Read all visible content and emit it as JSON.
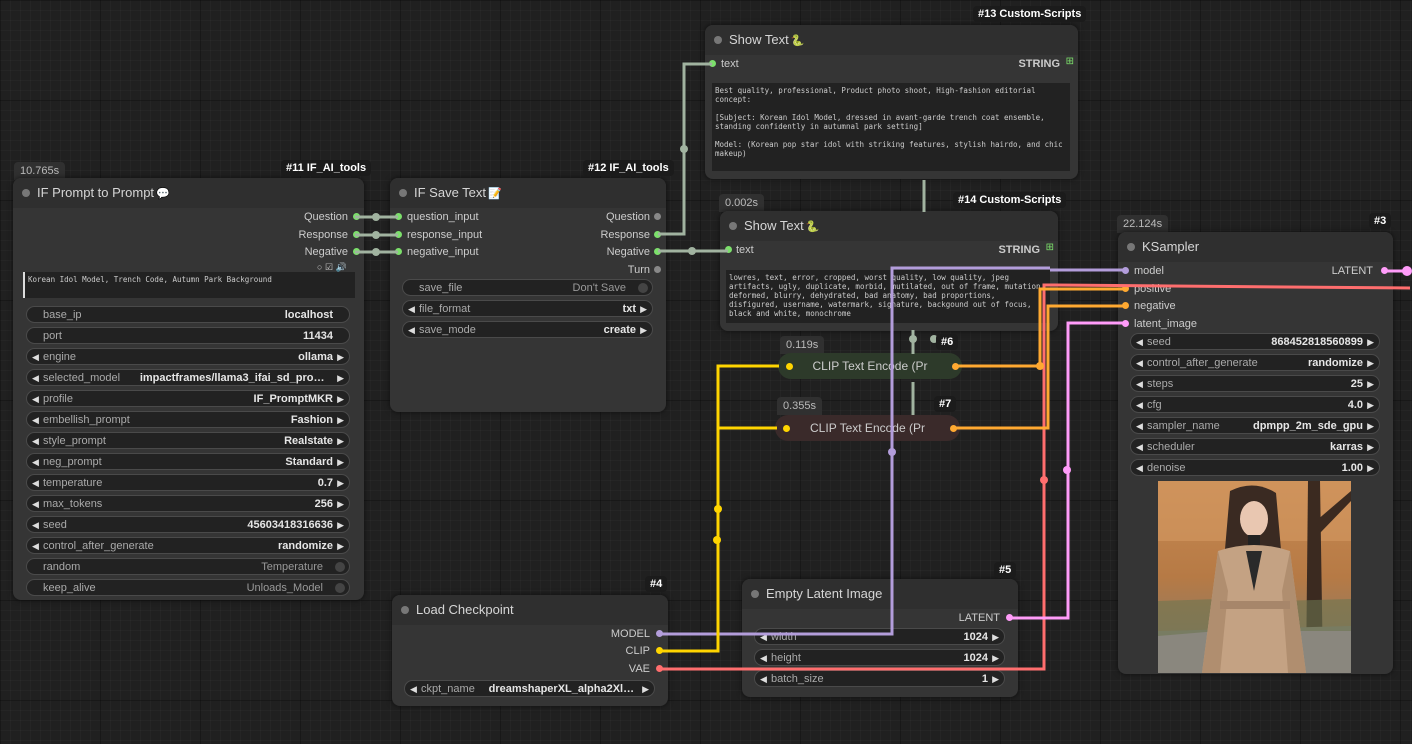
{
  "colors": {
    "clip": "#ffd500",
    "model": "#b39ddb",
    "vae": "#ff6e6e",
    "latent": "#ff9cf9",
    "conditioning": "#ffa931",
    "string": "#a1b3a0",
    "text_pin": "#7ce06b"
  },
  "node11": {
    "badge": "#11 IF_AI_tools",
    "timer": "10.765s",
    "title": "IF Prompt to Prompt",
    "title_icon": "speech-bubble-icon",
    "outputs": [
      "Question",
      "Response",
      "Negative"
    ],
    "input_text": "Korean Idol Model, Trench Code, Autumn Park Background",
    "base_ip": {
      "label": "base_ip",
      "value": "localhost"
    },
    "port": {
      "label": "port",
      "value": "11434"
    },
    "engine": {
      "label": "engine",
      "value": "ollama"
    },
    "selected_model": {
      "label": "selected_model",
      "value": "impactframes/llama3_ifai_sd_prompt_m..."
    },
    "profile": {
      "label": "profile",
      "value": "IF_PromptMKR"
    },
    "embellish_prompt": {
      "label": "embellish_prompt",
      "value": "Fashion"
    },
    "style_prompt": {
      "label": "style_prompt",
      "value": "Realstate"
    },
    "neg_prompt": {
      "label": "neg_prompt",
      "value": "Standard"
    },
    "temperature": {
      "label": "temperature",
      "value": "0.7"
    },
    "max_tokens": {
      "label": "max_tokens",
      "value": "256"
    },
    "seed": {
      "label": "seed",
      "value": "45603418316636"
    },
    "control_after_generate": {
      "label": "control_after_generate",
      "value": "randomize"
    },
    "random": {
      "label": "random",
      "value": "Temperature"
    },
    "keep_alive": {
      "label": "keep_alive",
      "value": "Unloads_Model"
    }
  },
  "node12": {
    "badge": "#12 IF_AI_tools",
    "title": "IF Save Text",
    "title_icon": "notepad-icon",
    "inputs": [
      "question_input",
      "response_input",
      "negative_input"
    ],
    "outputs": [
      "Question",
      "Response",
      "Negative",
      "Turn"
    ],
    "save_file": {
      "label": "save_file",
      "value": "Don't Save"
    },
    "file_format": {
      "label": "file_format",
      "value": "txt"
    },
    "save_mode": {
      "label": "save_mode",
      "value": "create"
    }
  },
  "node13": {
    "badge": "#13 Custom-Scripts",
    "title": "Show Text",
    "title_icon": "snake-icon",
    "input": "text",
    "output": "STRING",
    "text": "Best quality, professional, Product photo shoot, High-fashion editorial concept:\n\n[Subject: Korean Idol Model, dressed in avant-garde trench coat ensemble, standing confidently in autumnal park setting]\n\nModel: (Korean pop star idol with striking features, stylish hairdo, and chic makeup)"
  },
  "node14": {
    "badge": "#14 Custom-Scripts",
    "timer": "0.002s",
    "title": "Show Text",
    "title_icon": "snake-icon",
    "input": "text",
    "output": "STRING",
    "text": "lowres, text, error, cropped, worst quality, low quality, jpeg artifacts, ugly, duplicate, morbid, mutilated, out of frame, mutation, deformed, blurry, dehydrated, bad anatomy, bad proportions, disfigured, username, watermark, signature, backgound out of focus, black and white, monochrome"
  },
  "node6": {
    "badge": "#6",
    "timer": "0.119s",
    "title": "CLIP Text Encode (Pr"
  },
  "node7": {
    "badge": "#7",
    "timer": "0.355s",
    "title": "CLIP Text Encode (Pr"
  },
  "node4": {
    "badge": "#4",
    "title": "Load Checkpoint",
    "outputs": [
      "MODEL",
      "CLIP",
      "VAE"
    ],
    "ckpt_name": {
      "label": "ckpt_name",
      "value": "dreamshaperXL_alpha2Xl10..."
    }
  },
  "node5": {
    "badge": "#5",
    "title": "Empty Latent Image",
    "output": "LATENT",
    "width": {
      "label": "width",
      "value": "1024"
    },
    "height": {
      "label": "height",
      "value": "1024"
    },
    "batch_size": {
      "label": "batch_size",
      "value": "1"
    }
  },
  "node3": {
    "badge": "#3",
    "timer": "22.124s",
    "title": "KSampler",
    "inputs": [
      "model",
      "positive",
      "negative",
      "latent_image"
    ],
    "output": "LATENT",
    "seed": {
      "label": "seed",
      "value": "868452818560899"
    },
    "control_after_generate": {
      "label": "control_after_generate",
      "value": "randomize"
    },
    "steps": {
      "label": "steps",
      "value": "25"
    },
    "cfg": {
      "label": "cfg",
      "value": "4.0"
    },
    "sampler_name": {
      "label": "sampler_name",
      "value": "dpmpp_2m_sde_gpu"
    },
    "scheduler": {
      "label": "scheduler",
      "value": "karras"
    },
    "denoise": {
      "label": "denoise",
      "value": "1.00"
    }
  }
}
